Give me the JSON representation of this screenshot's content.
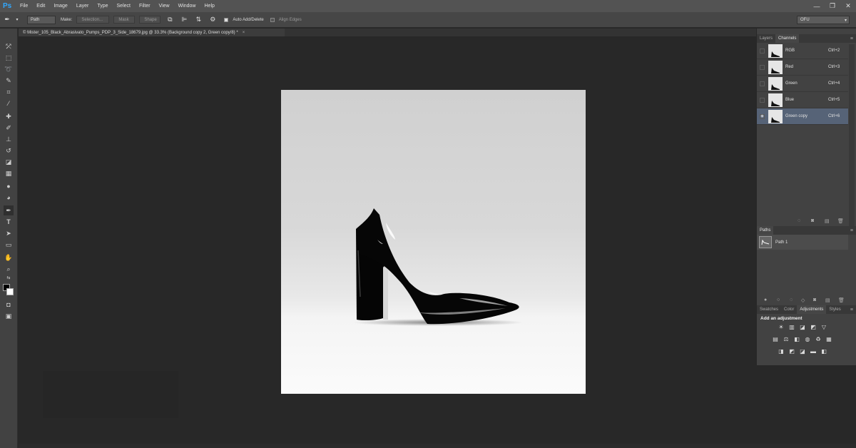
{
  "app": {
    "logo": "Ps"
  },
  "menu": [
    "File",
    "Edit",
    "Image",
    "Layer",
    "Type",
    "Select",
    "Filter",
    "View",
    "Window",
    "Help"
  ],
  "window_controls": {
    "minimize": "—",
    "restore": "❐",
    "close": "✕"
  },
  "options": {
    "tool_mode": "Path",
    "make_label": "Make:",
    "selection_btn": "Selection...",
    "mask_btn": "Mask",
    "shape_btn": "Shape",
    "auto_add_delete": "Auto Add/Delete",
    "align_edges": "Align Edges",
    "workspace": "OFU"
  },
  "document": {
    "tab_title": "© Mister_105_Black_Abrasivato_Pumps_PDP_3_Side_18679.jpg @ 33.3% (Background copy 2, Green copy/8) *",
    "close": "×"
  },
  "tools": [
    "move-tool",
    "marquee-tool",
    "lasso-tool",
    "quick-selection-tool",
    "crop-tool",
    "eyedropper-tool",
    "healing-brush-tool",
    "brush-tool",
    "clone-stamp-tool",
    "history-brush-tool",
    "eraser-tool",
    "gradient-tool",
    "blur-tool",
    "dodge-tool",
    "pen-tool",
    "type-tool",
    "path-selection-tool",
    "rectangle-tool",
    "hand-tool",
    "zoom-tool"
  ],
  "colors": {
    "foreground": "#000000",
    "background": "#ffffff",
    "selected_row": "#566377"
  },
  "channels_panel": {
    "tabs": [
      "Layers",
      "Channels"
    ],
    "active_tab": "Channels",
    "channels": [
      {
        "name": "RGB",
        "shortcut": "Ctrl+2",
        "selected": false
      },
      {
        "name": "Red",
        "shortcut": "Ctrl+3",
        "selected": false
      },
      {
        "name": "Green",
        "shortcut": "Ctrl+4",
        "selected": false
      },
      {
        "name": "Blue",
        "shortcut": "Ctrl+5",
        "selected": false
      },
      {
        "name": "Green copy",
        "shortcut": "Ctrl+6",
        "selected": true
      }
    ]
  },
  "paths_panel": {
    "tab": "Paths",
    "paths": [
      {
        "name": "Path 1"
      }
    ]
  },
  "adjustments_panel": {
    "tabs": [
      "Swatches",
      "Color",
      "Adjustments",
      "Styles"
    ],
    "active_tab": "Adjustments",
    "title": "Add an adjustment"
  }
}
